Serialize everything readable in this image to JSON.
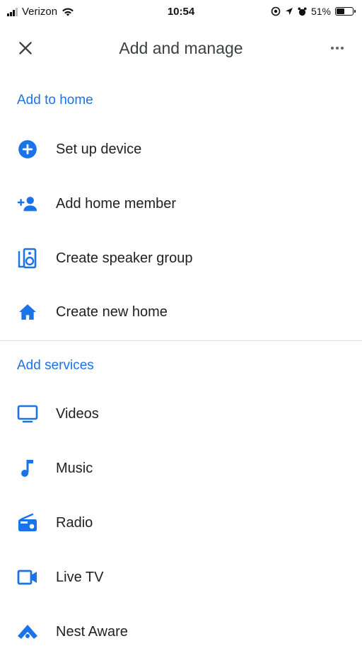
{
  "status_bar": {
    "carrier": "Verizon",
    "time": "10:54",
    "battery_text": "51%",
    "battery_level": 0.51
  },
  "app_bar": {
    "title": "Add and manage",
    "close_icon": "close-icon",
    "more_icon": "more-horizontal-icon"
  },
  "sections": {
    "add_to_home": {
      "heading": "Add to home",
      "items": [
        {
          "label": "Set up device",
          "icon": "add-circle-icon"
        },
        {
          "label": "Add home member",
          "icon": "person-add-icon"
        },
        {
          "label": "Create speaker group",
          "icon": "speaker-icon"
        },
        {
          "label": "Create new home",
          "icon": "home-icon"
        }
      ]
    },
    "add_services": {
      "heading": "Add services",
      "items": [
        {
          "label": "Videos",
          "icon": "tv-icon"
        },
        {
          "label": "Music",
          "icon": "music-note-icon"
        },
        {
          "label": "Radio",
          "icon": "radio-icon"
        },
        {
          "label": "Live TV",
          "icon": "video-camera-icon"
        },
        {
          "label": "Nest Aware",
          "icon": "nest-aware-icon"
        }
      ]
    }
  },
  "colors": {
    "accent": "#1a73e8",
    "text": "#202124",
    "divider": "#dadce0"
  }
}
